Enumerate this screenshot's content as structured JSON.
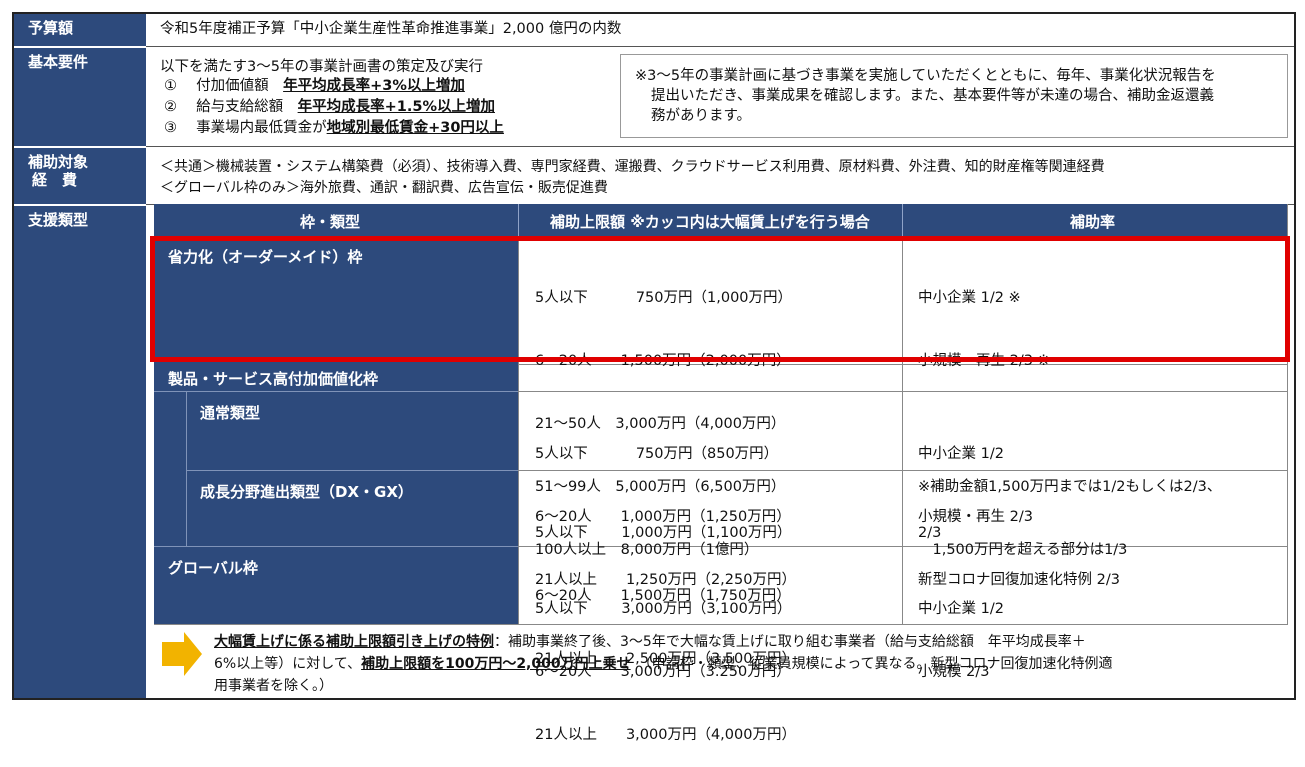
{
  "rows": {
    "budget": {
      "label": "予算額",
      "text": "令和5年度補正予算「中小企業生産性革命推進事業」2,000 億円の内数"
    },
    "requirements": {
      "label": "基本要件",
      "intro": "以下を満たす3～5年の事業計画書の策定及び実行",
      "items": [
        {
          "num": "①",
          "text": "付加価値額",
          "emph": "年平均成長率+3%以上増加"
        },
        {
          "num": "②",
          "text": "給与支給総額",
          "emph": "年平均成長率+1.5%以上増加"
        },
        {
          "num": "③",
          "text": "事業場内最低賃金が",
          "emph": "地域別最低賃金+30円以上"
        }
      ],
      "note_lines": [
        "※3～5年の事業計画に基づき事業を実施していただくとともに、毎年、事業化状況報告を",
        "提出いただき、事業成果を確認します。また、基本要件等が未達の場合、補助金返還義",
        "務があります。"
      ]
    },
    "expenses": {
      "label_lines": [
        "補助対象",
        "経　費"
      ],
      "lines": [
        "＜共通＞機械装置・システム構築費（必須）、技術導入費、専門家経費、運搬費、クラウドサービス利用費、原材料費、外注費、知的財産権等関連経費",
        "＜グローバル枠のみ＞海外旅費、通訳・翻訳費、広告宣伝・販売促進費"
      ]
    },
    "support": {
      "label": "支援類型",
      "headers": {
        "type": "枠・類型",
        "limit": "補助上限額 ※カッコ内は大幅賃上げを行う場合",
        "rate": "補助率"
      },
      "types": [
        {
          "name": "省力化（オーダーメイド）枠",
          "limits": [
            "5人以下　　 　750万円（1,000万円）",
            "6～20人　　1,500万円（2,000万円）",
            "21～50人　3,000万円（4,000万円）",
            "51～99人　5,000万円（6,500万円）",
            "100人以上　8,000万円（1億円）"
          ],
          "rates": [
            "中小企業 1/2 ※",
            "小規模・再生 2/3 ※",
            "",
            "※補助金額1,500万円までは1/2もしくは2/3、",
            "　1,500万円を超える部分は1/3"
          ]
        },
        {
          "name": "製品・サービス高付加価値化枠",
          "subtypes": [
            {
              "name": "通常類型",
              "limits": [
                "5人以下　　 　750万円（850万円）",
                "6～20人　　1,000万円（1,250万円）",
                "21人以上　　1,250万円（2,250万円）"
              ],
              "rates": [
                "中小企業 1/2",
                "小規模・再生 2/3",
                "新型コロナ回復加速化特例 2/3"
              ]
            },
            {
              "name": "成長分野進出類型（DX・GX）",
              "limits": [
                "5人以下　　 1,000万円（1,100万円）",
                "6～20人　　1,500万円（1,750万円）",
                "21人以上　　2,500万円（3,500万円）"
              ],
              "rates": [
                "2/3"
              ]
            }
          ]
        },
        {
          "name": "グローバル枠",
          "limits": [
            "5人以下　　 3,000万円（3,100万円）",
            "6～20人　　3,000万円（3.250万円）",
            "21人以上　　3,000万円（4,000万円）"
          ],
          "rates": [
            "中小企業 1/2",
            "小規模 2/3"
          ]
        }
      ],
      "footnote": {
        "head": "大幅賃上げに係る補助上限額引き上げの特例",
        "part1": "：補助事業終了後、3～5年で大幅な賃上げに取り組む事業者（給与支給総額　年平均成長率＋",
        "part2": "6%以上等）に対して、",
        "emph2": "補助上限額を100万円～2,000万円上乗せ",
        "part3": "　（申請枠・類型、従業員規模によって異なる。新型コロナ回復加速化特例適",
        "part4": "用事業者を除く。）"
      }
    }
  },
  "colors": {
    "navy": "#2d4a7c",
    "highlight_border": "#e00000",
    "arrow": "#f2b300"
  }
}
